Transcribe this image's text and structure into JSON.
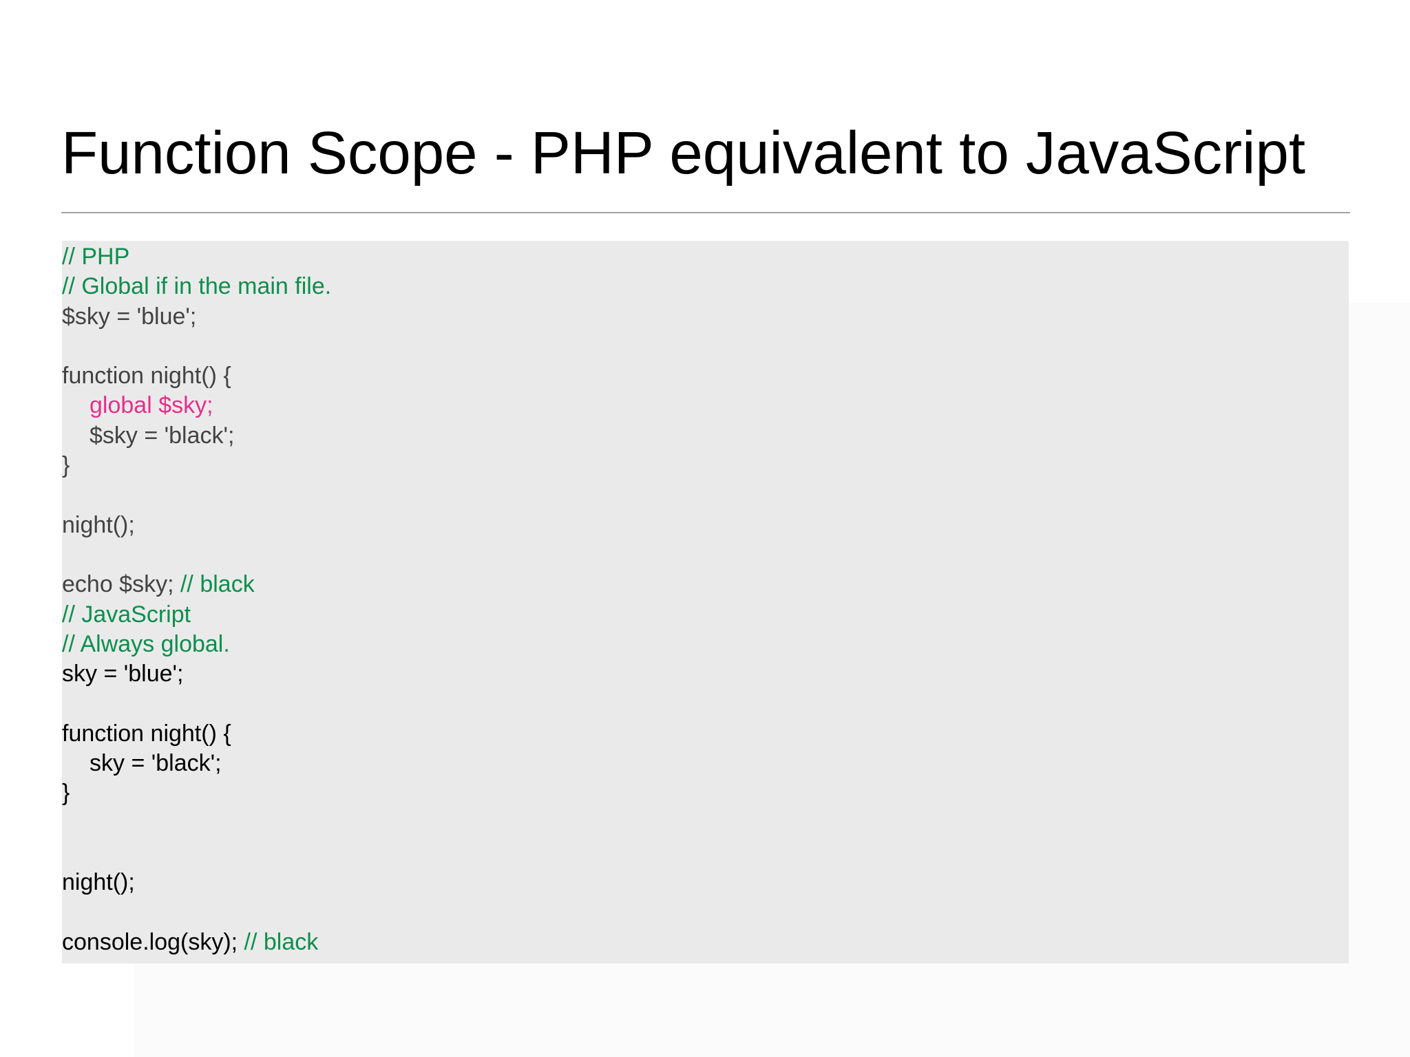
{
  "slide": {
    "title": "Function Scope - PHP equivalent to JavaScript"
  },
  "colors": {
    "comment": "#0b8f4c",
    "keyword": "#e6308a",
    "php_code": "#434343",
    "js_code": "#000000",
    "panel_bg": "#ebeaeb",
    "rule": "#a3a3a3"
  },
  "code": {
    "php": {
      "comment_lang": "// PHP",
      "comment_scope": "// Global if in the main file.",
      "assign_blue": "$sky = 'blue';",
      "func_open": "function night() {",
      "global_decl": "global $sky;",
      "assign_black": "$sky = 'black';",
      "func_close": "}",
      "call": "night();",
      "echo_stmt": "echo $sky;",
      "echo_comment": " // black"
    },
    "js": {
      "comment_lang": "// JavaScript",
      "comment_scope": "// Always global.",
      "assign_blue": "sky = 'blue';",
      "func_open": "function night() {",
      "assign_black": "sky = 'black';",
      "func_close": "}",
      "call": "night();",
      "log_stmt": "console.log(sky);",
      "log_comment": " // black"
    }
  }
}
